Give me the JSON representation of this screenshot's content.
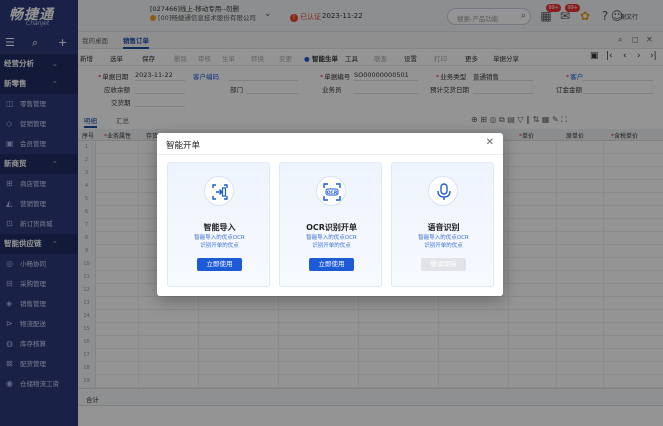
{
  "app": {
    "logo_cn": "畅捷通",
    "logo_en": "Chanjet",
    "company_line1": "[027466]线上-移动专用--勿删",
    "company_line2": "[00]畅捷通信息技术股份有限公司",
    "verify_status": "已认证",
    "date": "2023-11-22",
    "search_placeholder": "搜索-产品功能",
    "badge1": "99+",
    "badge2": "99+",
    "user_name": "谢文行"
  },
  "sidebar": {
    "groups": [
      {
        "label": "经营分析",
        "items": []
      },
      {
        "label": "新零售",
        "items": [
          {
            "label": "零售管理",
            "icon": "store-icon"
          },
          {
            "label": "促销管理",
            "icon": "promotion-icon"
          },
          {
            "label": "会员管理",
            "icon": "member-icon"
          }
        ]
      },
      {
        "label": "新商贸",
        "items": [
          {
            "label": "商店管理",
            "icon": "shop-icon"
          },
          {
            "label": "营销管理",
            "icon": "marketing-icon"
          },
          {
            "label": "新订货商城",
            "icon": "mall-icon"
          }
        ]
      },
      {
        "label": "智能供应链",
        "items": [
          {
            "label": "小畅协同",
            "icon": "collab-icon"
          },
          {
            "label": "采购管理",
            "icon": "purchase-icon"
          },
          {
            "label": "销售管理",
            "icon": "sales-icon"
          },
          {
            "label": "物流配送",
            "icon": "logistics-icon"
          },
          {
            "label": "库存核算",
            "icon": "inventory-icon"
          },
          {
            "label": "配货管理",
            "icon": "distribution-icon"
          },
          {
            "label": "仓储物流工资",
            "icon": "warehouse-icon"
          }
        ]
      }
    ]
  },
  "tabs": [
    "我的桌面",
    "销售订单"
  ],
  "toolbar": {
    "items": [
      "新增",
      "选单",
      "保存",
      "删除",
      "审核",
      "生单",
      "转换",
      "变更",
      "智能生单",
      "工具",
      "联查",
      "设置",
      "打印",
      "更多",
      "单据分享"
    ]
  },
  "form": {
    "doc_date_label": "单据日期",
    "doc_date_value": "2023-11-22",
    "customer_code_label": "客户编码",
    "doc_no_label": "单据编号",
    "doc_no_value": "SO00000000501",
    "biz_type_label": "业务类型",
    "biz_type_value": "普通销售",
    "customer_label": "客户",
    "receivable_label": "应收余额",
    "dept_label": "部门",
    "salesman_label": "业务员",
    "delivery_date_label": "预计交货日期",
    "deposit_label": "订金金额",
    "delivery_label": "交货期"
  },
  "subtabs": [
    "明细",
    "汇总"
  ],
  "table": {
    "headers": [
      "序号",
      "业务属性",
      "存货",
      "单价",
      "原单价",
      "含税单价"
    ],
    "row_numbers": [
      "1",
      "2",
      "3",
      "4",
      "5",
      "6",
      "7",
      "8",
      "9",
      "10",
      "11",
      "12",
      "13",
      "14",
      "15",
      "16",
      "17",
      "18",
      "19",
      "20"
    ],
    "total_label": "合计"
  },
  "modal": {
    "title": "智能开单",
    "cards": [
      {
        "title": "智能导入",
        "desc1": "智能导入的优点OCR",
        "desc2": "识别开单的优点",
        "button": "立即使用",
        "enabled": true
      },
      {
        "title": "OCR识别开单",
        "desc1": "智能导入的优点OCR",
        "desc2": "识别开单的优点",
        "button": "立即使用",
        "enabled": true
      },
      {
        "title": "语音识别",
        "desc1": "智能导入的优点OCR",
        "desc2": "识别开单的优点",
        "button": "敬请期待",
        "enabled": false
      }
    ],
    "ocr_icon_text": "OCR"
  },
  "colors": {
    "sidebar_bg": "#2b3a7a",
    "primary": "#1d5ad6",
    "accent_red": "#e8452a"
  }
}
